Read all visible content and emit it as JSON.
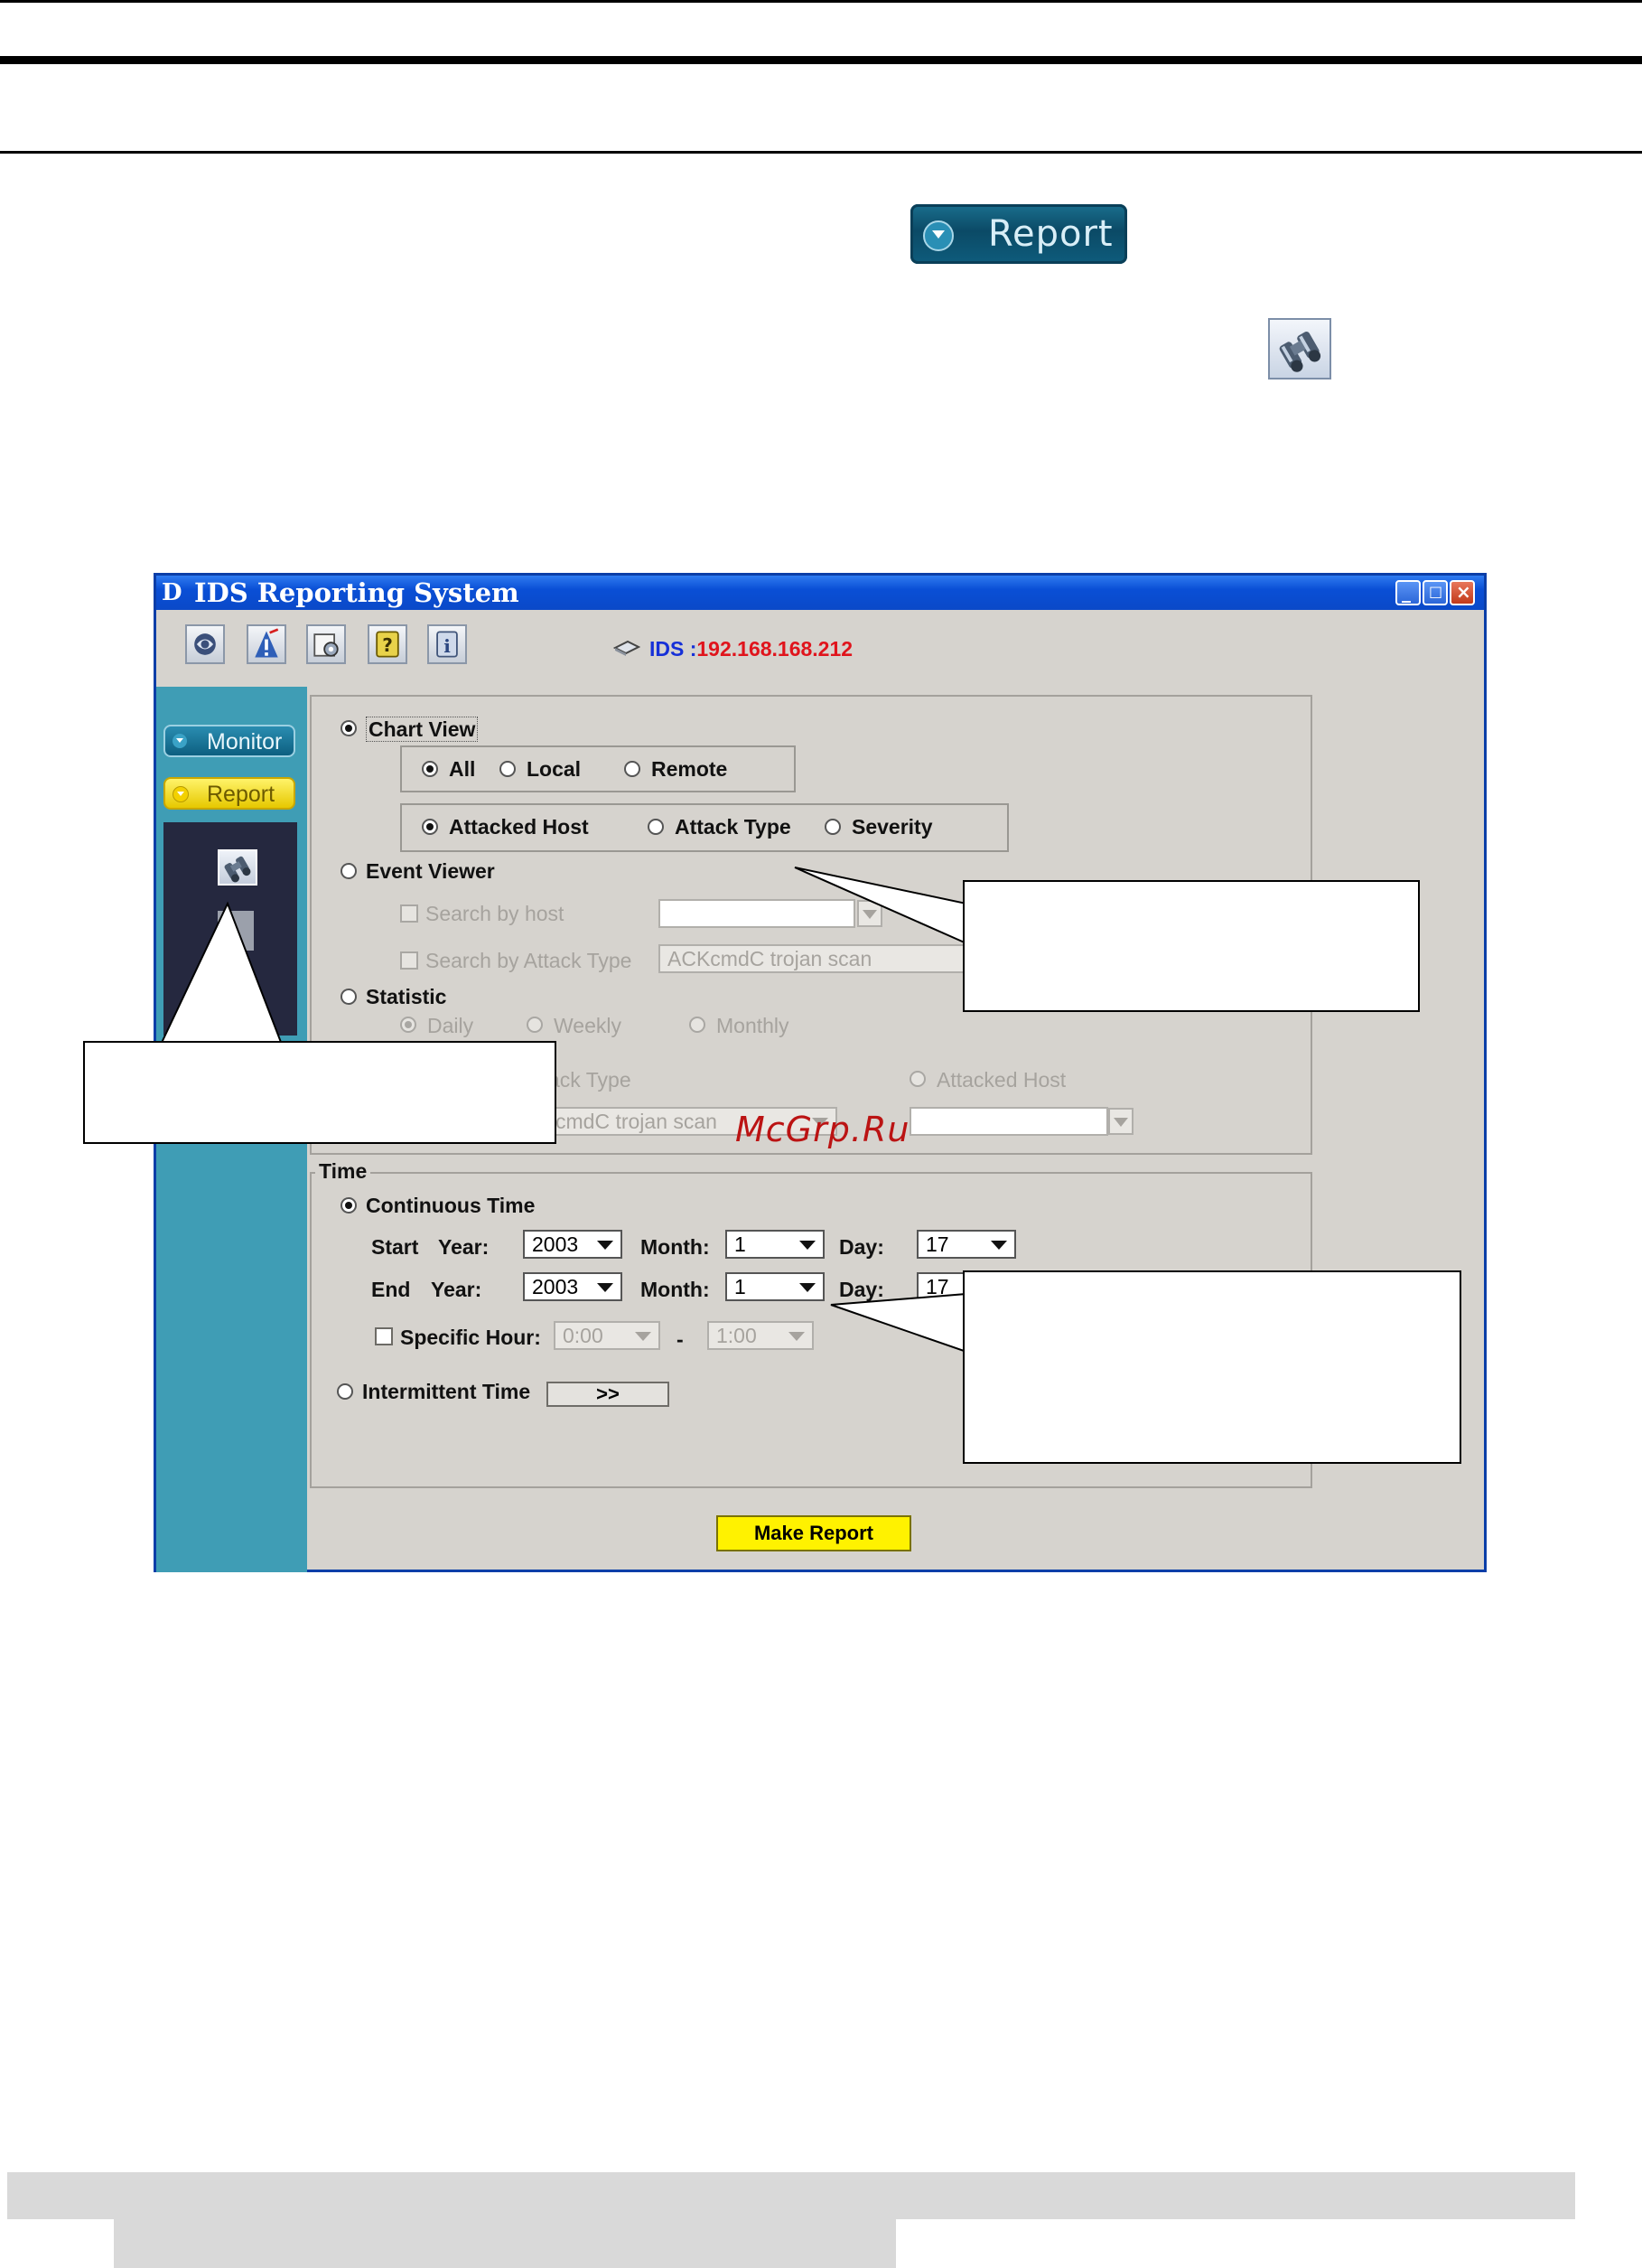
{
  "report_button_large": {
    "label": "Report"
  },
  "window": {
    "logo": "D",
    "title": "IDS Reporting System",
    "window_controls": [
      "minimize",
      "maximize",
      "close"
    ],
    "ids_label": "IDS :",
    "ids_address": "192.168.168.212",
    "toolbar_icons": [
      "globe-icon",
      "alert-icon",
      "settings-icon",
      "help-icon",
      "info-icon"
    ]
  },
  "sidebar": {
    "monitor_label": "Monitor",
    "report_label": "Report"
  },
  "chart_view": {
    "label": "Chart View",
    "selected": true,
    "scope_options": [
      "All",
      "Local",
      "Remote"
    ],
    "scope_selected": "All",
    "type_options": [
      "Attacked Host",
      "Attack Type",
      "Severity"
    ],
    "type_selected": "Attacked Host"
  },
  "event_viewer": {
    "label": "Event Viewer",
    "search_by_host_label": "Search by host",
    "search_by_host_value": "",
    "search_by_attack_type_label": "Search by Attack Type",
    "search_by_attack_type_value": "ACKcmdC trojan scan"
  },
  "statistic": {
    "label": "Statistic",
    "period_options": [
      "Daily",
      "Weekly",
      "Monthly"
    ],
    "period_selected": "Daily",
    "attack_type_label": "ack Type",
    "attack_type_value": "cmdC trojan scan",
    "attacked_host_label": "Attacked Host",
    "attacked_host_value": ""
  },
  "time": {
    "group_label": "Time",
    "continuous_label": "Continuous Time",
    "start_label": "Start",
    "end_label": "End",
    "year_label": "Year:",
    "month_label": "Month:",
    "day_label": "Day:",
    "start_year": "2003",
    "start_month": "1",
    "start_day": "17",
    "end_year": "2003",
    "end_month": "1",
    "end_day": "17",
    "specific_hour_label": "Specific Hour:",
    "hour_from": "0:00",
    "hour_dash": "-",
    "hour_to": "1:00",
    "intermittent_label": "Intermittent Time",
    "intermittent_button": ">>"
  },
  "make_report_button": "Make Report",
  "watermark": "McGrp.Ru",
  "colors": {
    "title_bar": "#0a4fd6",
    "sidebar": "#3f9db5",
    "ids_label": "#1630d8",
    "ids_address": "#e0141c",
    "make_report_button": "#fff200",
    "watermark": "#bb1313"
  }
}
